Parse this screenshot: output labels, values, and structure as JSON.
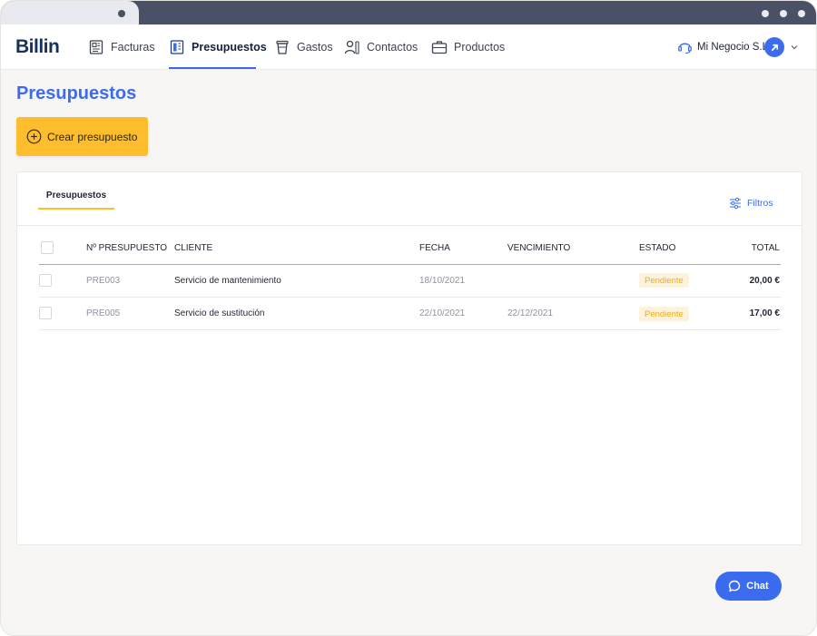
{
  "app": {
    "logo": "Billin"
  },
  "nav": {
    "items": [
      {
        "label": "Facturas",
        "icon": "invoice-icon"
      },
      {
        "label": "Presupuestos",
        "icon": "quote-icon",
        "active": true
      },
      {
        "label": "Gastos",
        "icon": "expense-cup-icon"
      },
      {
        "label": "Contactos",
        "icon": "contacts-icon"
      },
      {
        "label": "Productos",
        "icon": "briefcase-icon"
      }
    ],
    "company": "Mi Negocio S.L.",
    "support_icon": "support-headset-icon",
    "avatar_icon": "arrow-up-right-icon"
  },
  "page": {
    "title": "Presupuestos",
    "create_button": "Crear presupuesto"
  },
  "panel": {
    "tab": "Presupuestos",
    "filters": "Filtros",
    "columns": [
      "Nº presupuesto",
      "Cliente",
      "Fecha",
      "Vencimiento",
      "Estado",
      "Total"
    ],
    "rows": [
      {
        "number": "PRE003",
        "client": "Servicio de mantenimiento",
        "date": "18/10/2021",
        "due": "",
        "status": "Pendiente",
        "total": "20,00 €"
      },
      {
        "number": "PRE005",
        "client": "Servicio de sustitución",
        "date": "22/10/2021",
        "due": "22/12/2021",
        "status": "Pendiente",
        "total": "17,00 €"
      }
    ]
  },
  "chat": {
    "label": "Chat"
  },
  "colors": {
    "accent": "#3b6cf0",
    "primary_button": "#fdbd2c",
    "status_pending_bg": "#fdf3dc",
    "status_pending_text": "#f0ac14"
  }
}
